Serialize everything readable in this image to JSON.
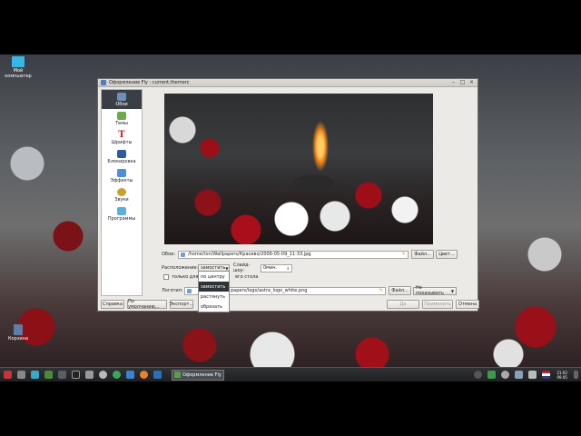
{
  "desktop": {
    "icons": [
      {
        "label": "Мой компьютер",
        "icon": "monitor-icon"
      },
      {
        "label": "Корзина",
        "icon": "trash-icon"
      }
    ]
  },
  "window": {
    "title": "Оформление Fly - current.themerc",
    "sidebar": [
      {
        "label": "Обои",
        "icon": "wallpaper-icon",
        "selected": true
      },
      {
        "label": "Темы",
        "icon": "themes-icon"
      },
      {
        "label": "Шрифты",
        "icon": "fonts-icon"
      },
      {
        "label": "Блокировка",
        "icon": "lock-screen-icon"
      },
      {
        "label": "Эффекты",
        "icon": "effects-icon"
      },
      {
        "label": "Звуки",
        "icon": "sounds-icon"
      },
      {
        "label": "Программы",
        "icon": "programs-icon"
      }
    ],
    "wallpaper": {
      "label": "Обои:",
      "path": "/home/ton/Wallpapers/Красиво/2006-05-09_11-33.jpg",
      "file_button": "Файл...",
      "color_button": "Цвет..."
    },
    "placement": {
      "label": "Расположение:",
      "value": "замостить",
      "options": [
        "по центру",
        "замостить",
        "растянуть",
        "обрезать"
      ],
      "highlighted": "замостить"
    },
    "slideshow": {
      "label": "Слайд-шоу:",
      "value": "0мин."
    },
    "only_desktop": {
      "label": "только для т",
      "label_tail": "его стола"
    },
    "logo": {
      "label": "Логотип:",
      "path": "papers/logo/astra_logo_white.png",
      "file_button": "Файл...",
      "show_combo": "Не показывать"
    },
    "buttons": {
      "help": "Справка",
      "defaults": "По умолчанию...",
      "export": "Экспорт...",
      "ok": "Да",
      "apply": "Применить",
      "cancel": "Отмена"
    }
  },
  "taskbar": {
    "task_label": "Оформление Fly",
    "clock_time": "21:02",
    "clock_date": "09.05"
  }
}
